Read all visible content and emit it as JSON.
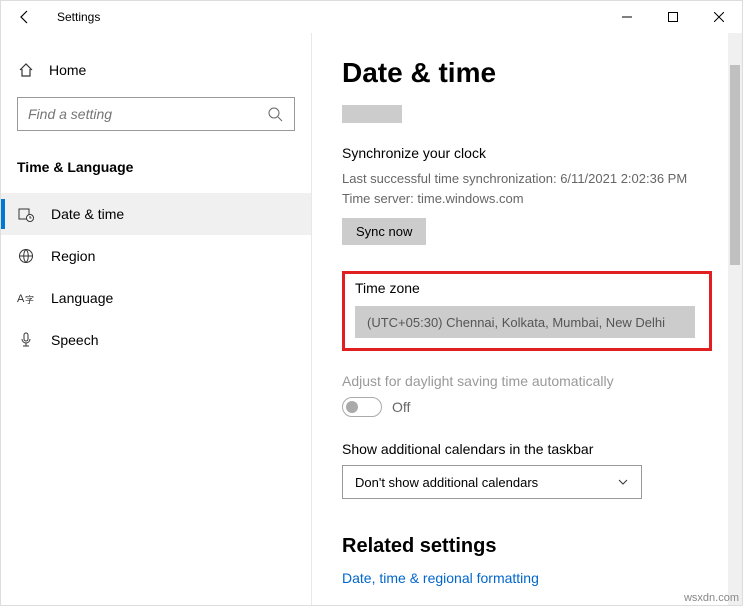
{
  "window": {
    "title": "Settings"
  },
  "sidebar": {
    "home": "Home",
    "search_placeholder": "Find a setting",
    "category": "Time & Language",
    "items": [
      {
        "label": "Date & time"
      },
      {
        "label": "Region"
      },
      {
        "label": "Language"
      },
      {
        "label": "Speech"
      }
    ]
  },
  "main": {
    "title": "Date & time",
    "sync_heading": "Synchronize your clock",
    "sync_last": "Last successful time synchronization: 6/11/2021 2:02:36 PM",
    "sync_server": "Time server: time.windows.com",
    "sync_button": "Sync now",
    "tz_label": "Time zone",
    "tz_value": "(UTC+05:30) Chennai, Kolkata, Mumbai, New Delhi",
    "dst_label": "Adjust for daylight saving time automatically",
    "dst_state": "Off",
    "cal_label": "Show additional calendars in the taskbar",
    "cal_value": "Don't show additional calendars",
    "related_heading": "Related settings",
    "related_link": "Date, time & regional formatting"
  },
  "watermark": "wsxdn.com"
}
